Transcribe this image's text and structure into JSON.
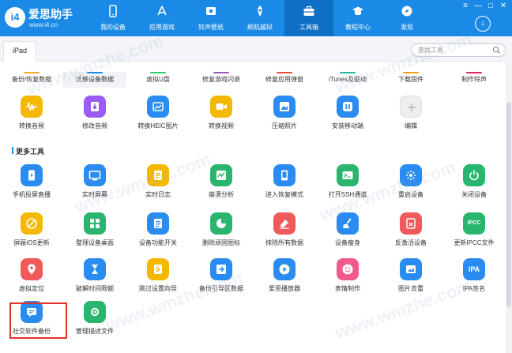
{
  "app": {
    "title": "爱思助手",
    "url": "www.i4.cn"
  },
  "nav": [
    {
      "label": "我的设备",
      "icon": "phone-icon"
    },
    {
      "label": "应用游戏",
      "icon": "appstore-icon"
    },
    {
      "label": "铃声壁纸",
      "icon": "music-icon"
    },
    {
      "label": "刷机越狱",
      "icon": "box-icon"
    },
    {
      "label": "工具箱",
      "icon": "toolbox-icon",
      "active": true
    },
    {
      "label": "教程中心",
      "icon": "graduation-cap-icon"
    },
    {
      "label": "发现",
      "icon": "compass-icon"
    }
  ],
  "device_tab": "iPad",
  "search": {
    "placeholder": "查找工具"
  },
  "quick_tabs": [
    {
      "label": "备份/恢复数据",
      "color": "#f5a623"
    },
    {
      "label": "迁移设备数据",
      "color": "#1a8ae6",
      "active": true
    },
    {
      "label": "虚拟U盘",
      "color": "#2ecc71"
    },
    {
      "label": "修复游戏闪退",
      "color": "#9b59b6"
    },
    {
      "label": "修复应用弹窗",
      "color": "#e74c3c"
    },
    {
      "label": "iTunes及驱动",
      "color": "#1abc9c"
    },
    {
      "label": "下载固件",
      "color": "#f39c12"
    },
    {
      "label": "制作铃声",
      "color": "#e91e63"
    }
  ],
  "tools_row1": [
    {
      "label": "转换音频",
      "color": "#f5b800",
      "icon": "audio-wave-icon"
    },
    {
      "label": "修改音频",
      "color": "#9b5cf6",
      "icon": "audio-edit-icon"
    },
    {
      "label": "转换HEIC图片",
      "color": "#2a8cf0",
      "icon": "image-convert-icon"
    },
    {
      "label": "转换视频",
      "color": "#f5b800",
      "icon": "video-icon"
    },
    {
      "label": "压缩照片",
      "color": "#2a8cf0",
      "icon": "photo-compress-icon"
    },
    {
      "label": "安装移动端",
      "color": "#2a8cf0",
      "icon": "i4-app-icon"
    },
    {
      "label": "编辑",
      "color": "#eeeeee",
      "icon": "plus-icon"
    }
  ],
  "section": {
    "title": "更多工具"
  },
  "tools_more": [
    {
      "label": "手机投屏直播",
      "color": "#2a8cf0",
      "icon": "cast-icon"
    },
    {
      "label": "实时屏幕",
      "color": "#2a8cf0",
      "icon": "screen-icon"
    },
    {
      "label": "实时日志",
      "color": "#f5b800",
      "icon": "log-icon"
    },
    {
      "label": "崩溃分析",
      "color": "#2ab56f",
      "icon": "crash-icon"
    },
    {
      "label": "进入恢复模式",
      "color": "#2a8cf0",
      "icon": "recovery-icon"
    },
    {
      "label": "打开SSH通道",
      "color": "#2ab56f",
      "icon": "terminal-icon"
    },
    {
      "label": "重启设备",
      "color": "#2a8cf0",
      "icon": "restart-icon"
    },
    {
      "label": "关闭设备",
      "color": "#2ab56f",
      "icon": "power-icon"
    },
    {
      "label": "屏蔽iOS更新",
      "color": "#f5b800",
      "icon": "block-update-icon"
    },
    {
      "label": "整理设备桌面",
      "color": "#2ab56f",
      "icon": "grid-icon"
    },
    {
      "label": "设备功能开关",
      "color": "#2a8cf0",
      "icon": "toggle-icon"
    },
    {
      "label": "删除顽固图标",
      "color": "#2ab56f",
      "icon": "delete-icon-icon"
    },
    {
      "label": "抹除所有数据",
      "color": "#f05a5a",
      "icon": "eraser-icon"
    },
    {
      "label": "设备瘦身",
      "color": "#2a8cf0",
      "icon": "broom-icon"
    },
    {
      "label": "反激活设备",
      "color": "#f05a5a",
      "icon": "deactivate-icon"
    },
    {
      "label": "更新IPCC文件",
      "color": "#2ab56f",
      "icon": "ipcc-icon"
    },
    {
      "label": "虚拟定位",
      "color": "#f05a5a",
      "icon": "location-icon"
    },
    {
      "label": "破解时间限额",
      "color": "#2a8cf0",
      "icon": "hourglass-icon"
    },
    {
      "label": "跳过设置向导",
      "color": "#f5b800",
      "icon": "skip-icon"
    },
    {
      "label": "备份引导区数据",
      "color": "#2a8cf0",
      "icon": "backup-boot-icon"
    },
    {
      "label": "爱思播放器",
      "color": "#2a8cf0",
      "icon": "play-icon"
    },
    {
      "label": "表情制作",
      "color": "#f05a8c",
      "icon": "emoji-icon"
    },
    {
      "label": "图片去重",
      "color": "#2a8cf0",
      "icon": "dedupe-icon"
    },
    {
      "label": "IPA签名",
      "color": "#2a8cf0",
      "icon": "ipa-icon"
    },
    {
      "label": "社交软件备份",
      "color": "#2a8cf0",
      "icon": "chat-backup-icon"
    },
    {
      "label": "管理描述文件",
      "color": "#2ab56f",
      "icon": "profile-gear-icon"
    }
  ],
  "icon_text": {
    "ipcc": "IPCC",
    "ipa": "IPA"
  },
  "colors": {
    "brand": "#1a8ae6",
    "highlight": "#e5312c"
  }
}
